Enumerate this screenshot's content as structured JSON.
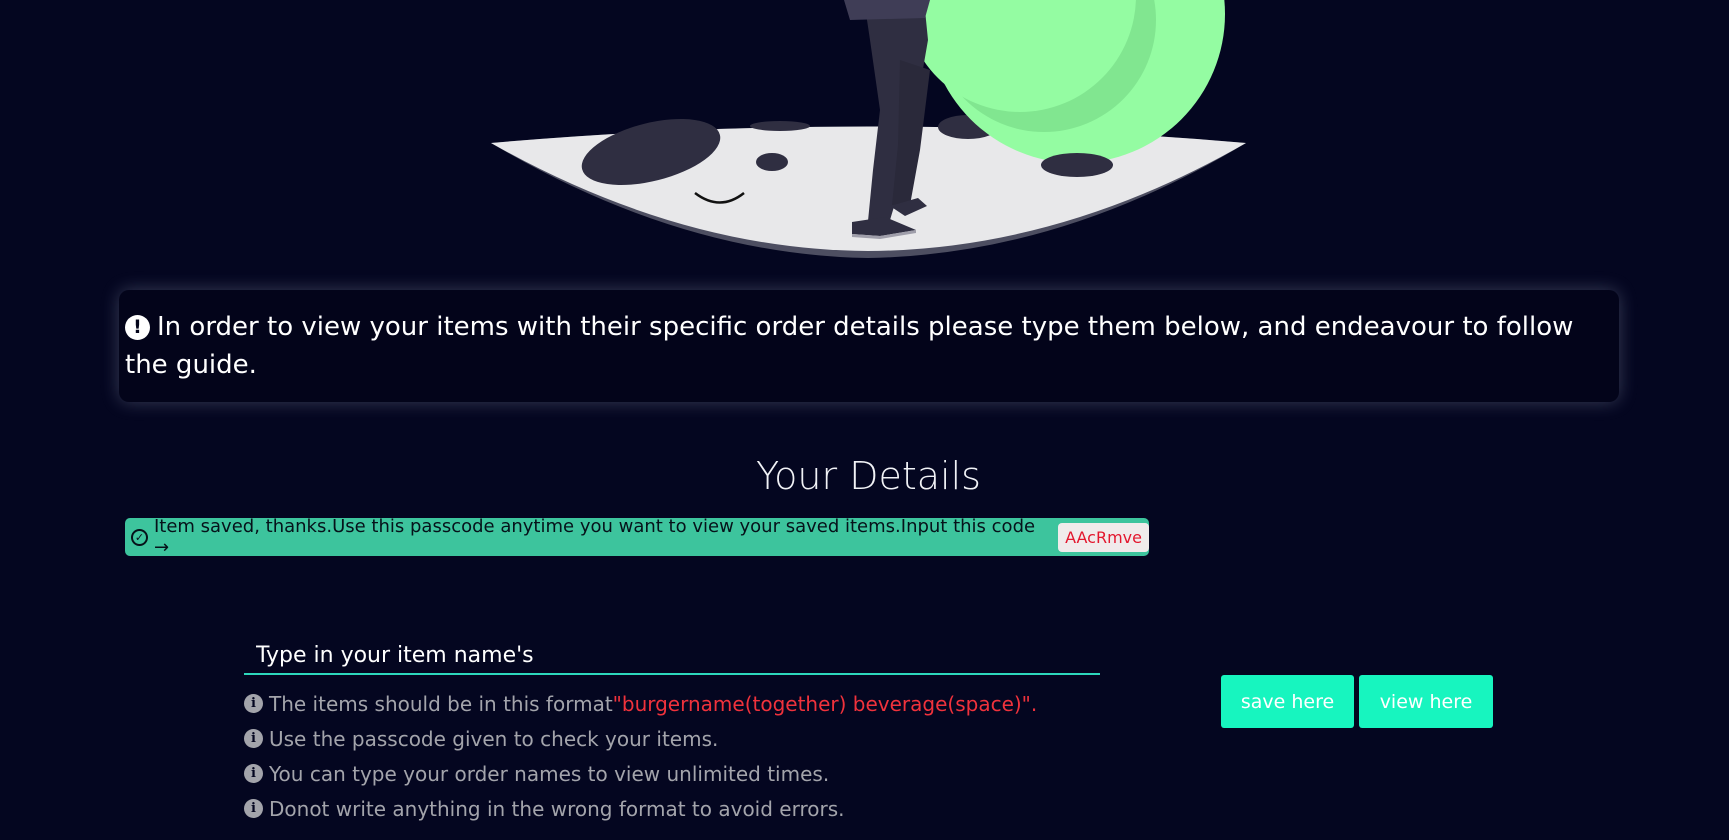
{
  "colors": {
    "background": "#040620",
    "accent": "#17f5bf",
    "success": "#3dc49d",
    "error_text": "#f0323c",
    "passcode_text": "#e3172e",
    "moon_ball": "#94fca2"
  },
  "hero": {
    "illustration_icon": "person-on-moon-with-ball-illustration"
  },
  "notice": {
    "icon": "exclamation-circle-icon",
    "text": "In order to view your items with their specific order details please type them below, and endeavour to follow the guide."
  },
  "details": {
    "title": "Your Details"
  },
  "success": {
    "icon": "check-circle-icon",
    "message": "Item saved, thanks.Use this passcode anytime you want to view your saved items.Input this code →",
    "passcode": "AAcRmve"
  },
  "item_input": {
    "placeholder": "Type in your item name's",
    "value": ""
  },
  "guide": {
    "icon": "info-circle-icon",
    "format_text": "The items should be in this format",
    "format_example": "\"burgername(together) beverage(space)\".",
    "line_2": "Use the passcode given to check your items.",
    "line_3": "You can type your order names to view unlimited times.",
    "line_4": "Donot write anything in the wrong format to avoid errors."
  },
  "buttons": {
    "save_label": "save here",
    "view_label": "view here"
  }
}
